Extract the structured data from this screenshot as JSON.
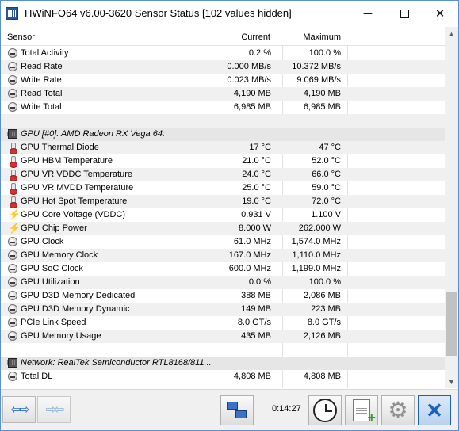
{
  "window": {
    "title": "HWiNFO64 v6.00-3620 Sensor Status [102 values hidden]",
    "minimize_glyph": "─",
    "close_glyph": "✕"
  },
  "columns": {
    "sensor": "Sensor",
    "current": "Current",
    "maximum": "Maximum"
  },
  "rows": [
    {
      "icon": "circle",
      "label": "Total Activity",
      "current": "0.2 %",
      "maximum": "100.0 %"
    },
    {
      "icon": "circle",
      "label": "Read Rate",
      "current": "0.000 MB/s",
      "maximum": "10.372 MB/s"
    },
    {
      "icon": "circle",
      "label": "Write Rate",
      "current": "0.023 MB/s",
      "maximum": "9.069 MB/s"
    },
    {
      "icon": "circle",
      "label": "Read Total",
      "current": "4,190 MB",
      "maximum": "4,190 MB"
    },
    {
      "icon": "circle",
      "label": "Write Total",
      "current": "6,985 MB",
      "maximum": "6,985 MB"
    },
    {
      "icon": "none",
      "label": "",
      "current": "",
      "maximum": ""
    },
    {
      "icon": "chip",
      "label": "GPU [#0]: AMD Radeon RX Vega 64:",
      "current": "",
      "maximum": "",
      "group": true
    },
    {
      "icon": "thermometer",
      "label": "GPU Thermal Diode",
      "current": "17 °C",
      "maximum": "47 °C"
    },
    {
      "icon": "thermometer",
      "label": "GPU HBM Temperature",
      "current": "21.0 °C",
      "maximum": "52.0 °C"
    },
    {
      "icon": "thermometer",
      "label": "GPU VR VDDC Temperature",
      "current": "24.0 °C",
      "maximum": "66.0 °C"
    },
    {
      "icon": "thermometer",
      "label": "GPU VR MVDD Temperature",
      "current": "25.0 °C",
      "maximum": "59.0 °C"
    },
    {
      "icon": "thermometer",
      "label": "GPU Hot Spot Temperature",
      "current": "19.0 °C",
      "maximum": "72.0 °C"
    },
    {
      "icon": "bolt",
      "label": "GPU Core Voltage (VDDC)",
      "current": "0.931 V",
      "maximum": "1.100 V"
    },
    {
      "icon": "bolt",
      "label": "GPU Chip Power",
      "current": "8.000 W",
      "maximum": "262.000 W"
    },
    {
      "icon": "circle",
      "label": "GPU Clock",
      "current": "61.0 MHz",
      "maximum": "1,574.0 MHz"
    },
    {
      "icon": "circle",
      "label": "GPU Memory Clock",
      "current": "167.0 MHz",
      "maximum": "1,110.0 MHz"
    },
    {
      "icon": "circle",
      "label": "GPU SoC Clock",
      "current": "600.0 MHz",
      "maximum": "1,199.0 MHz"
    },
    {
      "icon": "circle",
      "label": "GPU Utilization",
      "current": "0.0 %",
      "maximum": "100.0 %"
    },
    {
      "icon": "circle",
      "label": "GPU D3D Memory Dedicated",
      "current": "388 MB",
      "maximum": "2,086 MB"
    },
    {
      "icon": "circle",
      "label": "GPU D3D Memory Dynamic",
      "current": "149 MB",
      "maximum": "223 MB"
    },
    {
      "icon": "circle",
      "label": "PCIe Link Speed",
      "current": "8.0 GT/s",
      "maximum": "8.0 GT/s"
    },
    {
      "icon": "circle",
      "label": "GPU Memory Usage",
      "current": "435 MB",
      "maximum": "2,126 MB"
    },
    {
      "icon": "none",
      "label": "",
      "current": "",
      "maximum": ""
    },
    {
      "icon": "chip",
      "label": "Network: RealTek Semiconductor RTL8168/811...",
      "current": "",
      "maximum": "",
      "group": true
    },
    {
      "icon": "circle",
      "label": "Total DL",
      "current": "4,808 MB",
      "maximum": "4,808 MB"
    }
  ],
  "toolbar": {
    "timer": "0:14:27"
  },
  "colors": {
    "accent": "#2a6fd6",
    "window_border": "#5a8fd0",
    "group_row": "#e6e6e6"
  }
}
